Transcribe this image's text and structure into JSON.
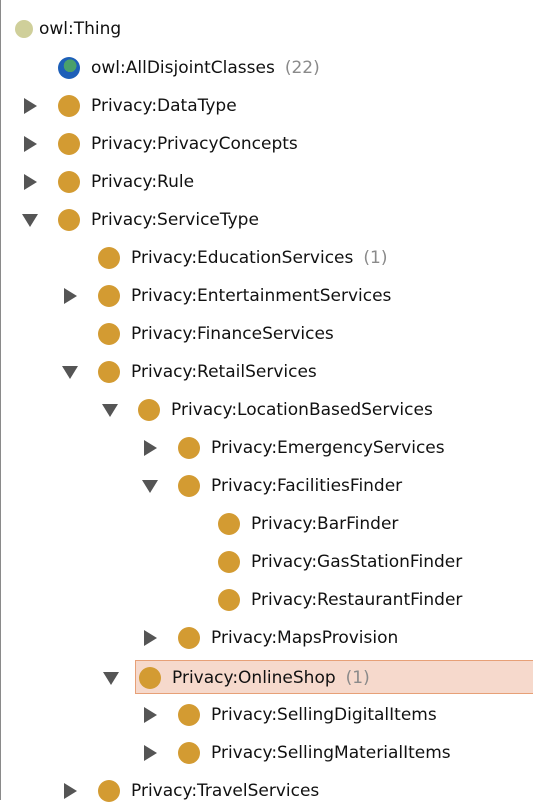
{
  "tree": [
    {
      "label": "owl:Thing",
      "icon": "thing",
      "toggle": "none",
      "level": 0
    },
    {
      "label": "owl:AllDisjointClasses",
      "count": "(22)",
      "icon": "globe",
      "toggle": "none",
      "level": 1
    },
    {
      "label": "Privacy:DataType",
      "icon": "class",
      "toggle": "closed",
      "level": 1
    },
    {
      "label": "Privacy:PrivacyConcepts",
      "icon": "class",
      "toggle": "closed",
      "level": 1
    },
    {
      "label": "Privacy:Rule",
      "icon": "class",
      "toggle": "closed",
      "level": 1
    },
    {
      "label": "Privacy:ServiceType",
      "icon": "class",
      "toggle": "open",
      "level": 1
    },
    {
      "label": "Privacy:EducationServices",
      "count": "(1)",
      "icon": "class",
      "toggle": "none",
      "level": 2
    },
    {
      "label": "Privacy:EntertainmentServices",
      "icon": "class",
      "toggle": "closed",
      "level": 2
    },
    {
      "label": "Privacy:FinanceServices",
      "icon": "class",
      "toggle": "none",
      "level": 2
    },
    {
      "label": "Privacy:RetailServices",
      "icon": "class",
      "toggle": "open",
      "level": 2
    },
    {
      "label": "Privacy:LocationBasedServices",
      "icon": "class",
      "toggle": "open",
      "level": 3
    },
    {
      "label": "Privacy:EmergencyServices",
      "icon": "class",
      "toggle": "closed",
      "level": 4
    },
    {
      "label": "Privacy:FacilitiesFinder",
      "icon": "class",
      "toggle": "open",
      "level": 4
    },
    {
      "label": "Privacy:BarFinder",
      "icon": "class",
      "toggle": "none",
      "level": 5
    },
    {
      "label": "Privacy:GasStationFinder",
      "icon": "class",
      "toggle": "none",
      "level": 5
    },
    {
      "label": "Privacy:RestaurantFinder",
      "icon": "class",
      "toggle": "none",
      "level": 5
    },
    {
      "label": "Privacy:MapsProvision",
      "icon": "class",
      "toggle": "closed",
      "level": 4
    },
    {
      "label": "Privacy:OnlineShop",
      "count": "(1)",
      "icon": "class",
      "toggle": "open",
      "level": 3,
      "selected": true
    },
    {
      "label": "Privacy:SellingDigitalItems",
      "icon": "class",
      "toggle": "closed",
      "level": 4
    },
    {
      "label": "Privacy:SellingMaterialItems",
      "icon": "class",
      "toggle": "closed",
      "level": 4
    },
    {
      "label": "Privacy:TravelServices",
      "icon": "class",
      "toggle": "closed",
      "level": 2
    }
  ]
}
